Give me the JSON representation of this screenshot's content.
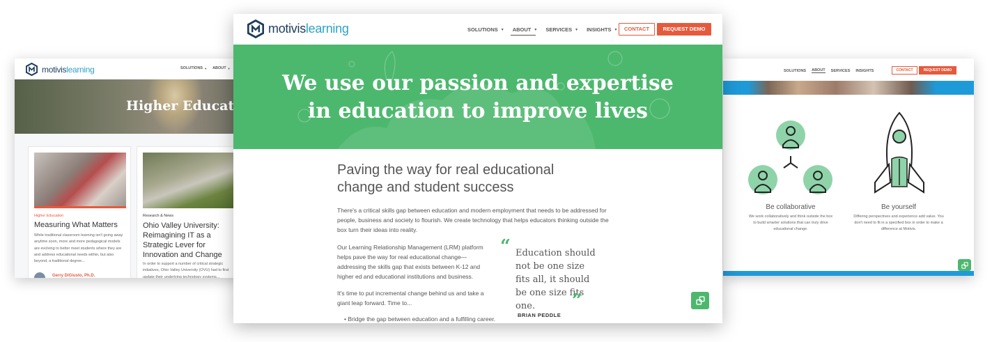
{
  "brand": {
    "name_bold": "motivis",
    "name_light": "learning"
  },
  "center": {
    "nav": [
      "SOLUTIONS",
      "ABOUT",
      "SERVICES",
      "INSIGHTS"
    ],
    "contact": "CONTACT",
    "demo": "REQUEST DEMO",
    "hero_line1": "We use our passion and expertise",
    "hero_line2": "in education to improve lives",
    "heading_line1": "Paving the way for real educational",
    "heading_line2": "change and student success",
    "para1": "There's a critical skills gap between education and modern employment that needs to be addressed for people, business and society to flourish. We create technology that helps educators thinking outside the box turn their ideas into reality.",
    "para2": "Our Learning Relationship Management (LRM) platform helps pave the way for real educational change—addressing the skills gap that exists between K-12 and higher ed and educational institutions and business.",
    "para3": "It's time to put incremental change behind us and take a giant leap forward. Time to...",
    "bullet1": "Bridge the gap between education and a fulfilling career.",
    "quote": "Education should not be one size fits all, it should be one size fits one.",
    "quote_author": "BRIAN PEDDLE"
  },
  "left": {
    "nav": [
      "SOLUTIONS",
      "ABOUT"
    ],
    "hero": "Higher Educati",
    "card1": {
      "category": "Higher Education",
      "title": "Measuring What Matters",
      "excerpt": "While traditional classroom learning isn't going away anytime soon, more and more pedagogical models are evolving to better meet students where they are and address educational needs within, but also beyond, a traditional degree...",
      "author": "Gerry DiGiusto, Ph.D."
    },
    "card2": {
      "category": "Research & News",
      "title": "Ohio Valley University: Reimagining IT as a Strategic Lever for Innovation and Change",
      "excerpt": "In order to support a number of critical strategic initiatives, Ohio Valley University (OVU) had to first update their underlying technology systems..."
    }
  },
  "right": {
    "nav": [
      "SOLUTIONS",
      "ABOUT",
      "SERVICES",
      "INSIGHTS"
    ],
    "contact": "CONTACT",
    "demo": "REQUEST DEMO",
    "col1_title": "Be collaborative",
    "col1_text": "We work collaboratively and think outside the box to build smarter solutions that can truly drive educational change.",
    "col2_title": "Be yourself",
    "col2_text": "Differing perspectives and experience add value.  You don't need to fit in a specified box in order to make a difference at Motivis."
  },
  "colors": {
    "green": "#4cb86e",
    "orange": "#e65a3c",
    "navy": "#1d3c5c",
    "teal": "#2ea3c8",
    "mint": "#8fd3a9",
    "blue": "#1f9ad8"
  },
  "icons": [
    "logo-icon",
    "chevron-down-icon",
    "chat-icon",
    "quote-open-icon",
    "quote-close-icon",
    "person-icon",
    "rocket-icon"
  ]
}
